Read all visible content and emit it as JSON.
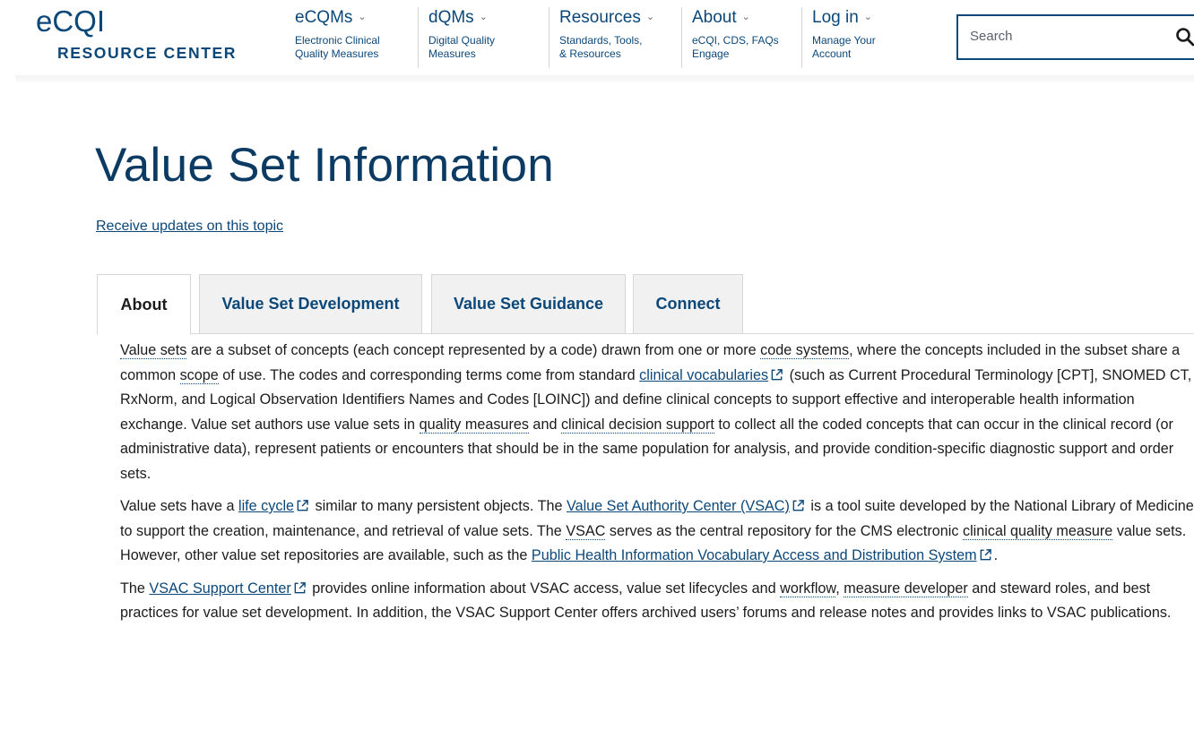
{
  "logo": {
    "top": "eCQI",
    "bottom": "RESOURCE CENTER"
  },
  "nav": [
    {
      "title": "eCQMs",
      "sub1": "Electronic Clinical",
      "sub2": "Quality Measures"
    },
    {
      "title": "dQMs",
      "sub1": "Digital Quality",
      "sub2": "Measures"
    },
    {
      "title": "Resources",
      "sub1": "Standards, Tools,",
      "sub2": "& Resources"
    },
    {
      "title": "About",
      "sub1": "eCQI, CDS, FAQs",
      "sub2": "Engage"
    },
    {
      "title": "Log in",
      "sub1": "Manage Your",
      "sub2": "Account"
    }
  ],
  "search": {
    "placeholder": "Search"
  },
  "page": {
    "title": "Value Set Information",
    "updates_link": "Receive updates on this topic"
  },
  "tabs": [
    {
      "label": "About",
      "active": true
    },
    {
      "label": "Value Set Development",
      "active": false
    },
    {
      "label": "Value Set Guidance",
      "active": false
    },
    {
      "label": "Connect",
      "active": false
    }
  ],
  "content": {
    "p1": {
      "gl_value_sets": "Value sets",
      "t1": " are a subset of concepts (each concept represented by a code) drawn from one or more ",
      "gl_code_systems": "code systems",
      "t2": ", where the concepts included in the subset share a common ",
      "gl_scope": "scope",
      "t3": " of use. The codes and corresponding terms come from standard ",
      "lk_clinical_vocab": "clinical vocabularies",
      "t4": " (such as Current Procedural Terminology [CPT], SNOMED CT, RxNorm, and Logical Observation Identifiers Names and Codes [LOINC]) and define clinical concepts to support effective and interoperable health information exchange. Value set authors use value sets in ",
      "gl_quality_measures": "quality measures",
      "t5": " and ",
      "gl_cds": "clinical decision support",
      "t6": " to collect all the coded concepts that can occur in the clinical record (or administrative data), represent patients or encounters that should be in the same population for analysis, and provide condition-specific diagnostic support and order sets."
    },
    "p2": {
      "t1": "Value sets have a ",
      "lk_life_cycle": "life cycle",
      "t2": " similar to many persistent objects. The ",
      "lk_vsac": "Value Set Authority Center (VSAC)",
      "t3": " is a tool suite developed by the National Library of Medicine to support the creation, maintenance, and retrieval of value sets. The ",
      "gl_vsac": "VSAC",
      "t4": " serves as the central repository for the CMS electronic ",
      "gl_cqm": "clinical quality measure",
      "t5": " value sets. However, other value set repositories are available, such as the ",
      "lk_phin": "Public Health Information Vocabulary Access and Distribution System",
      "t6": "."
    },
    "p3": {
      "t1": "The ",
      "lk_support": "VSAC Support Center",
      "t2": " provides online information about VSAC access, value set lifecycles and ",
      "gl_workflow": "workflow",
      "t3": ", ",
      "gl_measure_dev": "measure developer",
      "t4": " and steward roles, and best practices for value set development. In addition, the VSAC Support Center offers archived users’ forums and release notes and provides links to VSAC publications."
    }
  }
}
